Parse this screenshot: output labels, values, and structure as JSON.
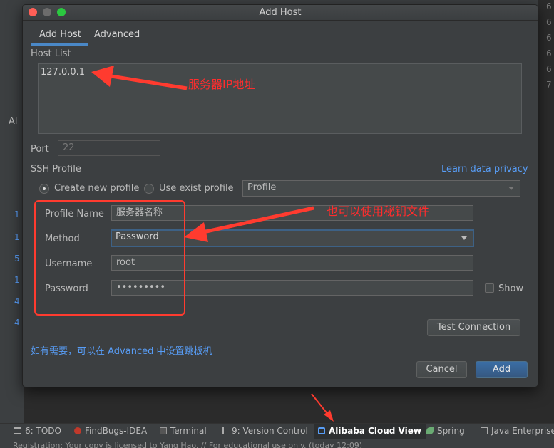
{
  "window": {
    "title": "Add Host"
  },
  "tabs": [
    {
      "label": "Add Host",
      "active": true
    },
    {
      "label": "Advanced",
      "active": false
    }
  ],
  "host_list": {
    "label": "Host List",
    "items": [
      "127.0.0.1"
    ]
  },
  "port": {
    "label": "Port",
    "value": "22"
  },
  "ssh_profile": {
    "label": "SSH Profile",
    "learn_link": "Learn data privacy",
    "option_create": "Create new profile",
    "option_exist": "Use exist profile",
    "selected_option": "create",
    "profile_select": "Profile"
  },
  "form": {
    "profile_name_label": "Profile Name",
    "profile_name_value": "服务器名称",
    "method_label": "Method",
    "method_value": "Password",
    "username_label": "Username",
    "username_value": "root",
    "password_label": "Password",
    "password_value": "•••••••••",
    "show_label": "Show"
  },
  "buttons": {
    "test_connection": "Test Connection",
    "cancel": "Cancel",
    "add": "Add"
  },
  "hint_link": "如有需要，可以在 Advanced 中设置跳板机",
  "annotations": {
    "ip_note": "服务器IP地址",
    "key_note": "也可以使用秘钥文件"
  },
  "ide": {
    "left_label": "Al",
    "left_numbers": [
      "1",
      "1",
      "5",
      "1",
      "4",
      "4"
    ],
    "right_numbers": [
      "6",
      "6",
      "6",
      "6",
      "6",
      "7"
    ],
    "bottom_tools": [
      {
        "label": "6: TODO",
        "icon": "todo-icon"
      },
      {
        "label": "FindBugs-IDEA",
        "icon": "findbugs-icon"
      },
      {
        "label": "Terminal",
        "icon": "terminal-icon"
      },
      {
        "label": "9: Version Control",
        "icon": "version-control-icon"
      },
      {
        "label": "Alibaba Cloud View",
        "icon": "alibaba-cloud-icon"
      },
      {
        "label": "Spring",
        "icon": "spring-icon"
      },
      {
        "label": "Java Enterprise",
        "icon": "java-enterprise-icon"
      }
    ],
    "status_text": "Registration: Your copy is licensed to Yang Hao. // For educational use only. (today 12:09)"
  },
  "colors": {
    "accent": "#589df6",
    "annotation": "#ff3b2f",
    "primary_button": "#365880"
  }
}
